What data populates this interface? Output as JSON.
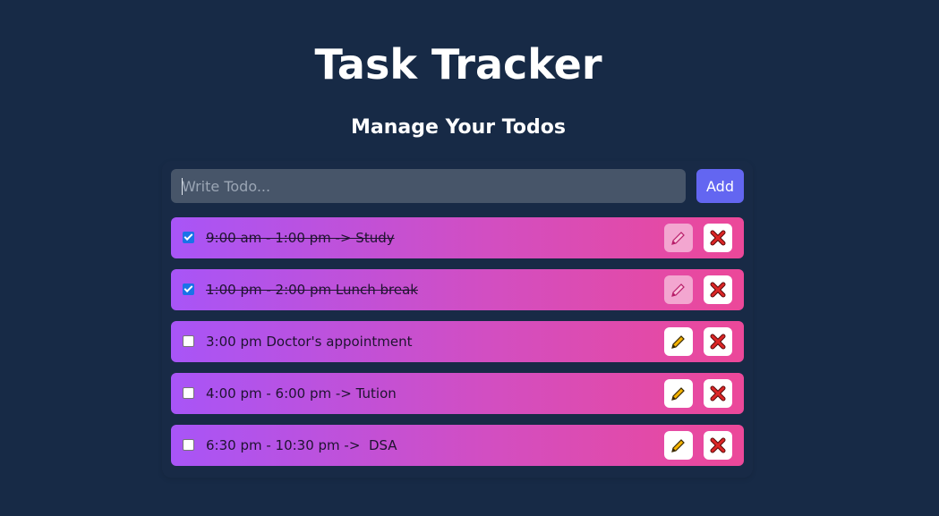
{
  "header": {
    "title": "Task Tracker",
    "subtitle": "Manage Your Todos"
  },
  "form": {
    "input_placeholder": "Write Todo...",
    "input_value": "",
    "add_label": "Add"
  },
  "todos": [
    {
      "text": "9:00 am - 1:00 pm -> Study",
      "completed": true
    },
    {
      "text": "1:00 pm - 2:00 pm Lunch break",
      "completed": true
    },
    {
      "text": "3:00 pm Doctor's appointment",
      "completed": false
    },
    {
      "text": "4:00 pm - 6:00 pm -> Tution",
      "completed": false
    },
    {
      "text": "6:30 pm - 10:30 pm ->  DSA",
      "completed": false
    }
  ],
  "icons": {
    "edit": "pencil-icon",
    "delete": "cross-mark-icon"
  },
  "colors": {
    "background": "#172a46",
    "input": "#475569",
    "accent": "#6366f1",
    "todo_gradient_start": "#a855f7",
    "todo_gradient_end": "#ec4899",
    "delete": "#dc2626"
  }
}
